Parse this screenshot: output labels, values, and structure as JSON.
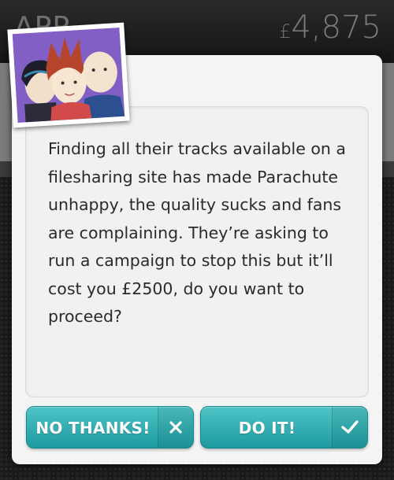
{
  "header": {
    "title": "APP",
    "balance_currency": "£",
    "balance_amount": "4,875"
  },
  "dialog": {
    "message": "Finding all their tracks available on a filesharing site has made Parachute unhappy, the quality sucks and fans are complaining. They’re asking to run a campaign to stop this but it’ll cost you £2500, do you want to proceed?",
    "decline_label": "NO THANKS!",
    "decline_icon": "close-icon",
    "accept_label": "DO IT!",
    "accept_icon": "check-icon"
  },
  "colors": {
    "button_teal": "#2aaeb2",
    "background_dark": "#1b1b1b"
  }
}
